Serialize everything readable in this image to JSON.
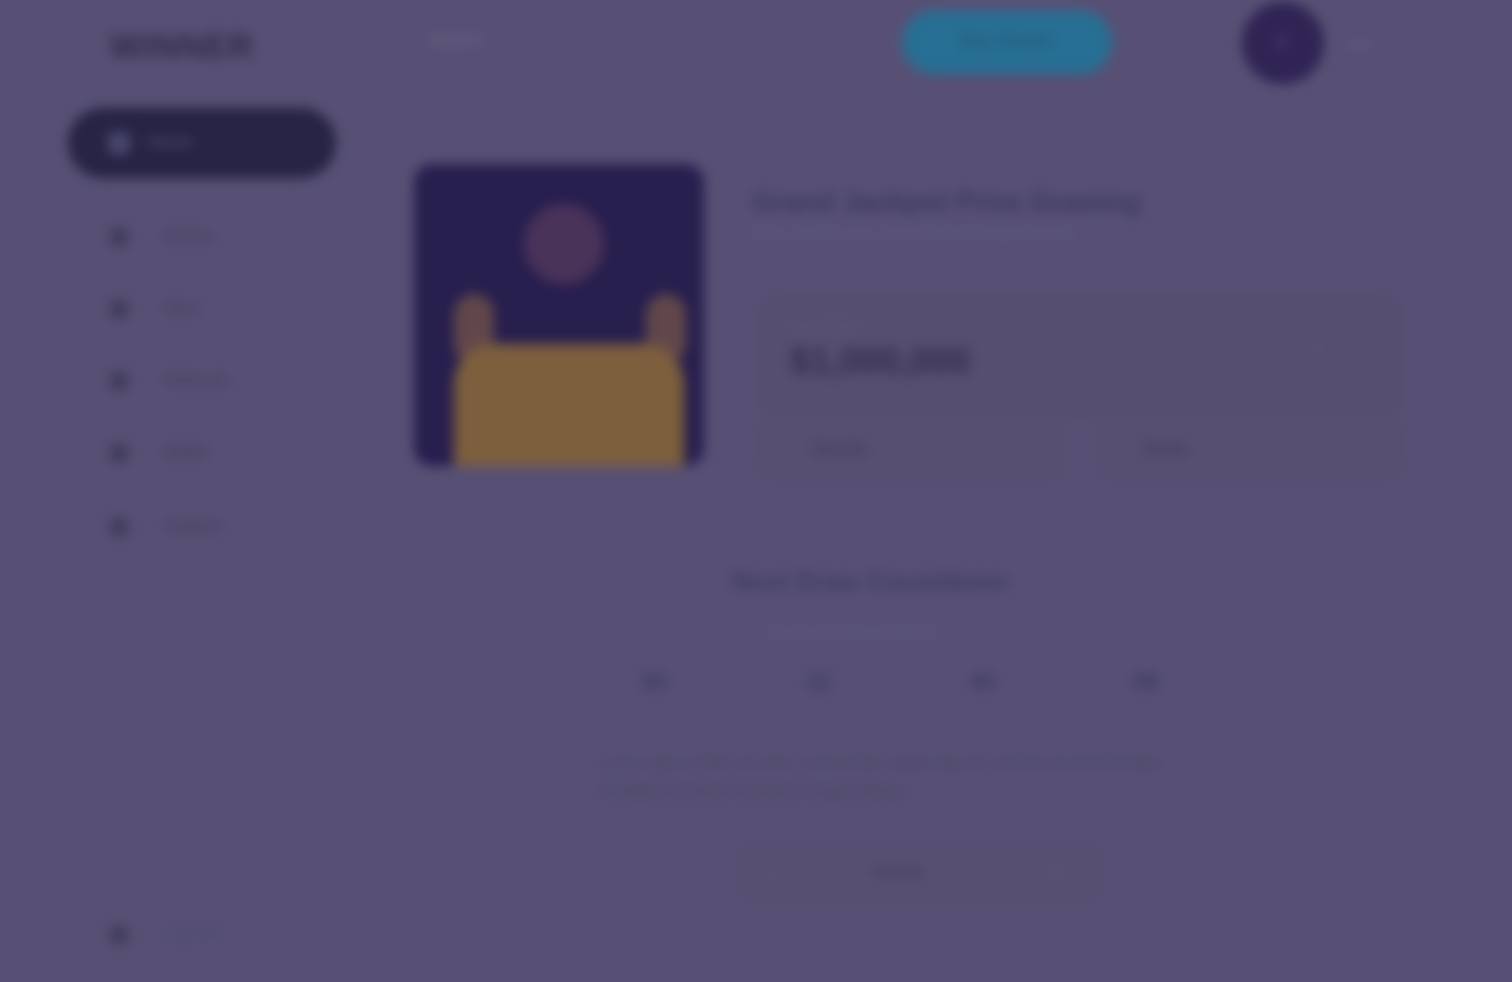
{
  "header": {
    "logo": "WINNER",
    "search_placeholder": "Search",
    "cta_label": "Buy Tickets",
    "username": "User"
  },
  "sidebar": {
    "active_item": {
      "label": "Home"
    },
    "items": [
      {
        "label": "Entries"
      },
      {
        "label": "Wins"
      },
      {
        "label": "Referrals"
      },
      {
        "label": "Wallet"
      },
      {
        "label": "Support"
      }
    ],
    "logout_label": "Log Out"
  },
  "main": {
    "title": "Grand Jackpot Prize Drawing",
    "subtitle": "Enter now for your chance to win the grand prize",
    "price_label": "Grand Prize",
    "price_value": "$1,000,000",
    "left_button_label": "Details",
    "right_button_label": "Rules",
    "section_title": "Next Draw Countdown",
    "section_subtitle": "Time remaining until draw",
    "timer": [
      "03",
      "12",
      "45",
      "09"
    ],
    "description": "Lorem ipsum dolor sit amet, consectetur adipiscing elit, sed do eiusmod tempor incididunt ut labore et dolore magna aliqua.",
    "stepper_label": "Tickets",
    "stepper_minus": "−",
    "stepper_plus": "+"
  },
  "colors": {
    "background": "#5d5679",
    "accent": "#1d7fa3",
    "active_nav": "#1c1b3a"
  }
}
